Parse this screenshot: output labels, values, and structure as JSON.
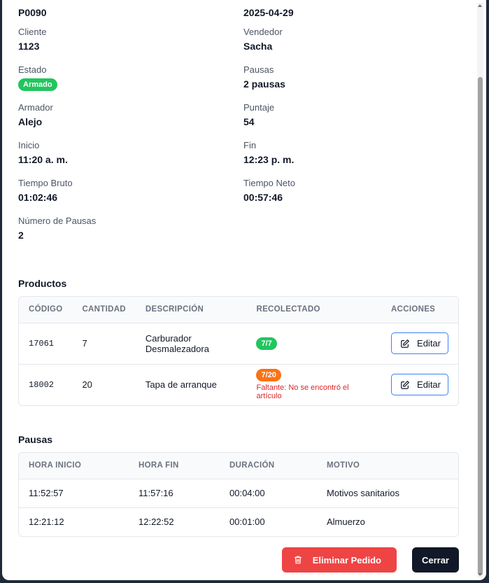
{
  "header": {
    "order_id": "P0090",
    "date": "2025-04-29"
  },
  "fields": {
    "cliente": {
      "label": "Cliente",
      "value": "1123"
    },
    "vendedor": {
      "label": "Vendedor",
      "value": "Sacha"
    },
    "estado": {
      "label": "Estado",
      "value": "Armado",
      "color": "#22c55e"
    },
    "pausas": {
      "label": "Pausas",
      "value": "2 pausas"
    },
    "armador": {
      "label": "Armador",
      "value": "Alejo"
    },
    "puntaje": {
      "label": "Puntaje",
      "value": "54"
    },
    "inicio": {
      "label": "Inicio",
      "value": "11:20 a. m."
    },
    "fin": {
      "label": "Fin",
      "value": "12:23 p. m."
    },
    "tiempo_bruto": {
      "label": "Tiempo Bruto",
      "value": "01:02:46"
    },
    "tiempo_neto": {
      "label": "Tiempo Neto",
      "value": "00:57:46"
    },
    "numero_pausas": {
      "label": "Número de Pausas",
      "value": "2"
    }
  },
  "productos": {
    "title": "Productos",
    "columns": [
      "CÓDIGO",
      "CANTIDAD",
      "DESCRIPCIÓN",
      "RECOLECTADO",
      "ACCIONES"
    ],
    "rows": [
      {
        "codigo": "17061",
        "cantidad": "7",
        "descripcion": "Carburador Desmalezadora",
        "recolectado": "7/7",
        "badge_color": "#22c55e",
        "faltante_label": "",
        "faltante_text": "",
        "action": "Editar"
      },
      {
        "codigo": "18002",
        "cantidad": "20",
        "descripcion": "Tapa de arranque",
        "recolectado": "7/20",
        "badge_color": "#f97316",
        "faltante_label": "Faltante:",
        "faltante_text": "No se encontró el artículo",
        "action": "Editar"
      }
    ]
  },
  "pausas_table": {
    "title": "Pausas",
    "columns": [
      "HORA INICIO",
      "HORA FIN",
      "DURACIÓN",
      "MOTIVO"
    ],
    "rows": [
      {
        "inicio": "11:52:57",
        "fin": "11:57:16",
        "duracion": "00:04:00",
        "motivo": "Motivos sanitarios"
      },
      {
        "inicio": "12:21:12",
        "fin": "12:22:52",
        "duracion": "00:01:00",
        "motivo": "Almuerzo"
      }
    ]
  },
  "actions": {
    "delete_label": "Eliminar Pedido",
    "close_label": "Cerrar"
  },
  "colors": {
    "danger": "#ef4444",
    "dark": "#111827",
    "accent_border": "#3b82f6"
  },
  "icons": {
    "edit": "pencil-square-icon",
    "delete": "trash-icon"
  }
}
